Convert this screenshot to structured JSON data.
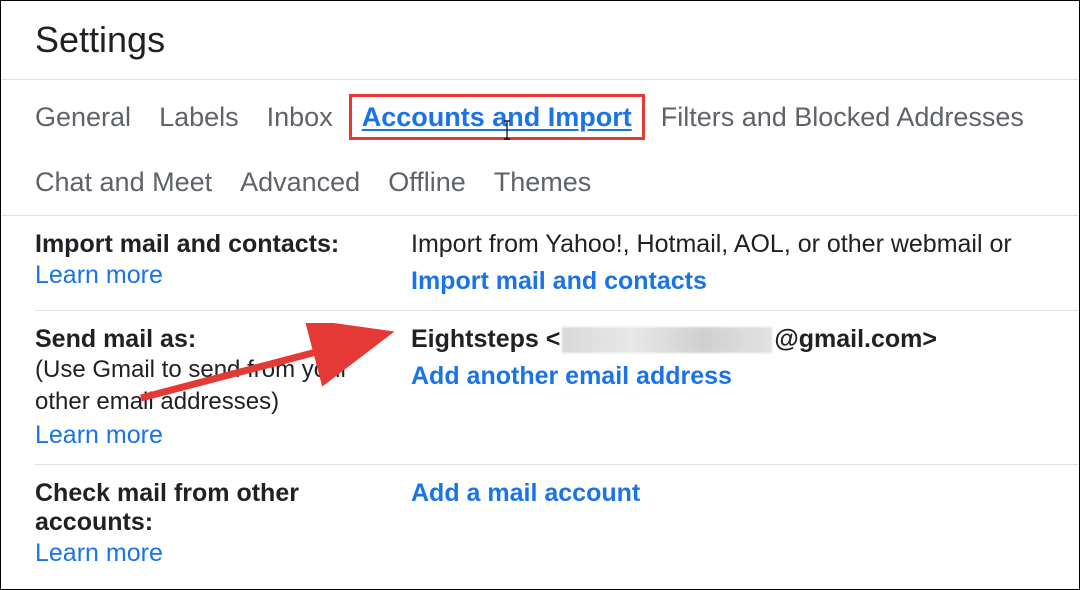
{
  "page": {
    "title": "Settings"
  },
  "tabs": {
    "general": "General",
    "labels": "Labels",
    "inbox": "Inbox",
    "accounts_import": "Accounts and Import",
    "filters_blocked": "Filters and Blocked Addresses",
    "chat_meet": "Chat and Meet",
    "advanced": "Advanced",
    "offline": "Offline",
    "themes": "Themes"
  },
  "sections": {
    "import_mail": {
      "title": "Import mail and contacts:",
      "learn_more": "Learn more",
      "desc": "Import from Yahoo!, Hotmail, AOL, or other webmail or",
      "action": "Import mail and contacts"
    },
    "send_mail_as": {
      "title": "Send mail as:",
      "sub": "(Use Gmail to send from your other email addresses)",
      "learn_more": "Learn more",
      "email_name": "Eightsteps",
      "email_domain": "@gmail.com>",
      "action": "Add another email address"
    },
    "check_mail": {
      "title": "Check mail from other accounts:",
      "learn_more": "Learn more",
      "action": "Add a mail account"
    }
  }
}
